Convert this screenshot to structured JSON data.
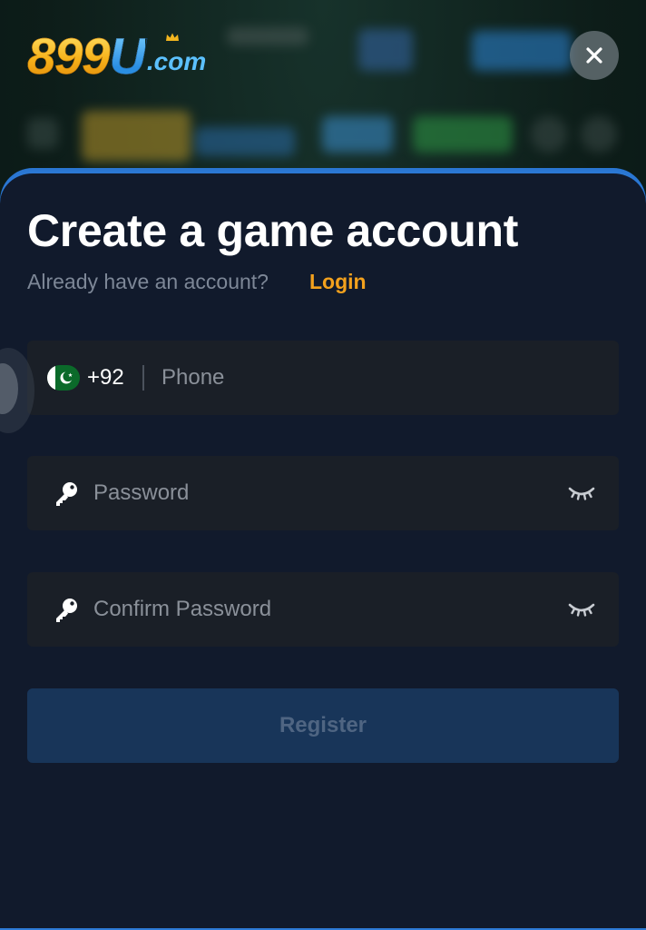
{
  "brand": {
    "logo_main": "899",
    "logo_u": "U",
    "logo_suffix": ".com"
  },
  "modal": {
    "title": "Create a game account",
    "subtitle": "Already have an account?",
    "login_link": "Login",
    "phone": {
      "country_code": "+92",
      "placeholder": "Phone",
      "value": ""
    },
    "password": {
      "placeholder": "Password",
      "value": ""
    },
    "confirm_password": {
      "placeholder": "Confirm Password",
      "value": ""
    },
    "register_label": "Register"
  },
  "icons": {
    "close": "close-icon",
    "flag": "pakistan-flag-icon",
    "key": "key-icon",
    "eye": "eye-closed-icon"
  },
  "colors": {
    "accent_link": "#f3a11d",
    "sheet_bg": "#111a2c",
    "field_bg": "#1a1f27",
    "register_bg": "#183559",
    "register_text": "#4f6582",
    "sheet_border": "#2b78d4"
  }
}
